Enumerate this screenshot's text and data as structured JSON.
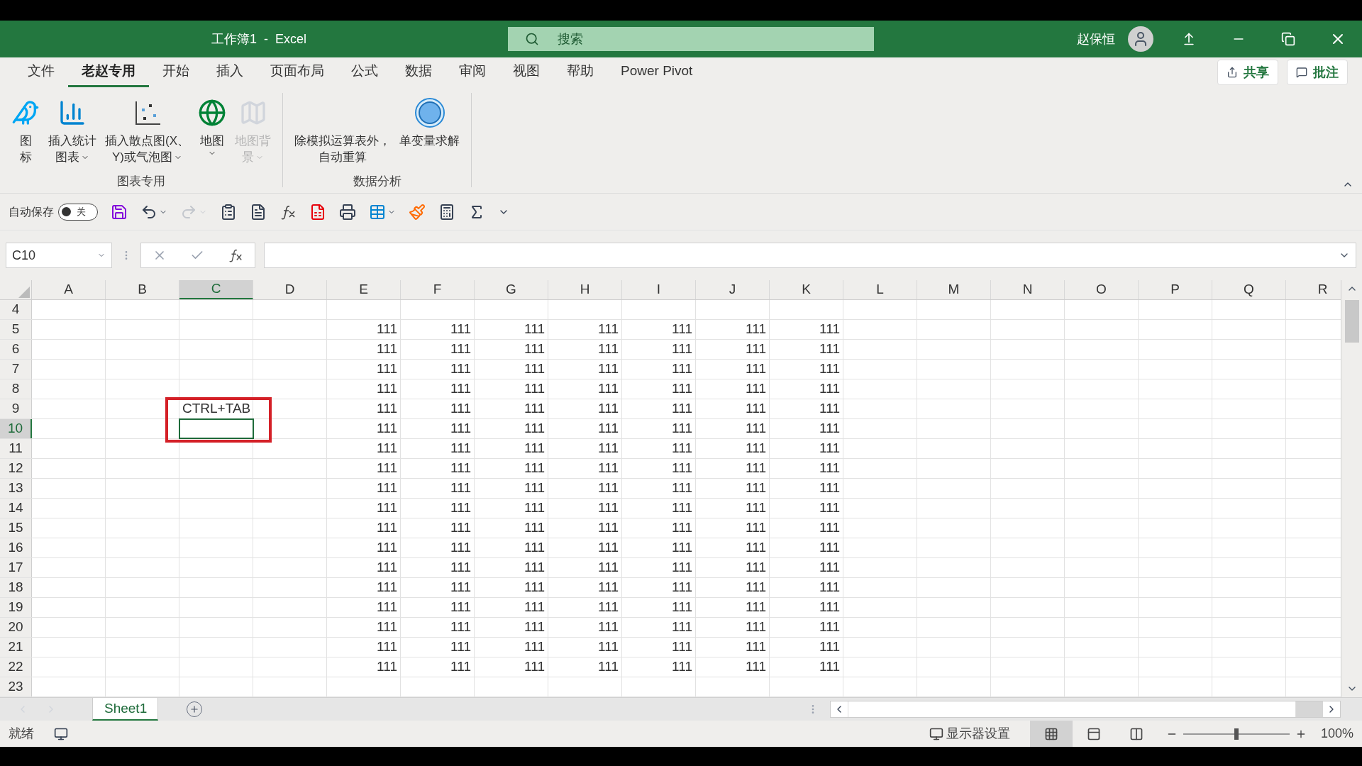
{
  "window": {
    "title": "工作簿1  -  Excel",
    "user": "赵保恒"
  },
  "search": {
    "placeholder": "搜索"
  },
  "ribbon_tabs": [
    {
      "label": "文件",
      "selected": false
    },
    {
      "label": "老赵专用",
      "selected": true
    },
    {
      "label": "开始",
      "selected": false
    },
    {
      "label": "插入",
      "selected": false
    },
    {
      "label": "页面布局",
      "selected": false
    },
    {
      "label": "公式",
      "selected": false
    },
    {
      "label": "数据",
      "selected": false
    },
    {
      "label": "审阅",
      "selected": false
    },
    {
      "label": "视图",
      "selected": false
    },
    {
      "label": "帮助",
      "selected": false
    },
    {
      "label": "Power Pivot",
      "selected": false
    }
  ],
  "ribbon_actions": [
    {
      "kind": "share",
      "label": "共享"
    },
    {
      "kind": "comment",
      "label": "批注"
    }
  ],
  "ribbon_groups": [
    {
      "label": "图表专用",
      "items": [
        {
          "kind": "icons",
          "lines": [
            "图",
            "标"
          ],
          "menu": false,
          "disabled": false
        },
        {
          "kind": "bar_chart",
          "lines": [
            "插入统计",
            "图表"
          ],
          "menu": true,
          "disabled": false
        },
        {
          "kind": "scatter",
          "lines": [
            "插入散点图(X、",
            "Y)或气泡图"
          ],
          "menu": true,
          "disabled": false
        },
        {
          "kind": "globe",
          "lines": [
            "地图"
          ],
          "menu": true,
          "disabled": false
        },
        {
          "kind": "map_background",
          "lines": [
            "地图背",
            "景"
          ],
          "menu": true,
          "disabled": true
        }
      ]
    },
    {
      "label": "数据分析",
      "items": [
        {
          "kind": "recalc",
          "lines": [
            "除模拟运算表外，",
            "自动重算"
          ],
          "menu": false,
          "disabled": false
        },
        {
          "kind": "goal_seek",
          "lines": [
            "单变量求解"
          ],
          "menu": false,
          "disabled": false
        }
      ]
    }
  ],
  "autosave": {
    "label": "自动保存",
    "on": false,
    "state_text": "关"
  },
  "quick_access": [
    {
      "kind": "save",
      "menu": false,
      "disabled": false
    },
    {
      "kind": "undo",
      "menu": true,
      "disabled": false
    },
    {
      "kind": "redo",
      "menu": true,
      "disabled": true
    },
    {
      "kind": "form",
      "menu": false,
      "disabled": false
    },
    {
      "kind": "document",
      "menu": false,
      "disabled": false
    },
    {
      "kind": "function",
      "menu": false,
      "disabled": false
    },
    {
      "kind": "report",
      "menu": false,
      "disabled": false
    },
    {
      "kind": "print",
      "menu": false,
      "disabled": false
    },
    {
      "kind": "freeze",
      "menu": true,
      "disabled": false
    },
    {
      "kind": "brush",
      "menu": false,
      "disabled": false
    },
    {
      "kind": "calculator",
      "menu": false,
      "disabled": false
    },
    {
      "kind": "sum",
      "menu": false,
      "disabled": false
    },
    {
      "kind": "customize",
      "menu": false,
      "disabled": false
    }
  ],
  "formula_bar": {
    "name_box": "C10"
  },
  "columns": [
    {
      "label": "A",
      "selected": false
    },
    {
      "label": "B",
      "selected": false
    },
    {
      "label": "C",
      "selected": true
    },
    {
      "label": "D",
      "selected": false
    },
    {
      "label": "E",
      "selected": false
    },
    {
      "label": "F",
      "selected": false
    },
    {
      "label": "G",
      "selected": false
    },
    {
      "label": "H",
      "selected": false
    },
    {
      "label": "I",
      "selected": false
    },
    {
      "label": "J",
      "selected": false
    },
    {
      "label": "K",
      "selected": false
    },
    {
      "label": "L",
      "selected": false
    },
    {
      "label": "M",
      "selected": false
    },
    {
      "label": "N",
      "selected": false
    },
    {
      "label": "O",
      "selected": false
    },
    {
      "label": "P",
      "selected": false
    },
    {
      "label": "Q",
      "selected": false
    },
    {
      "label": "R",
      "selected": false
    }
  ],
  "rows": [
    {
      "label": "4",
      "selected": false
    },
    {
      "label": "5",
      "selected": false,
      "cells": [
        null,
        null,
        null,
        null,
        "111",
        "111",
        "111",
        "111",
        "111",
        "111",
        "111"
      ]
    },
    {
      "label": "6",
      "selected": false,
      "cells": [
        null,
        null,
        null,
        null,
        "111",
        "111",
        "111",
        "111",
        "111",
        "111",
        "111"
      ]
    },
    {
      "label": "7",
      "selected": false,
      "cells": [
        null,
        null,
        null,
        null,
        "111",
        "111",
        "111",
        "111",
        "111",
        "111",
        "111"
      ]
    },
    {
      "label": "8",
      "selected": false,
      "cells": [
        null,
        null,
        null,
        null,
        "111",
        "111",
        "111",
        "111",
        "111",
        "111",
        "111"
      ]
    },
    {
      "label": "9",
      "selected": false,
      "cells": [
        null,
        null,
        "CTRL+TAB",
        null,
        "111",
        "111",
        "111",
        "111",
        "111",
        "111",
        "111"
      ]
    },
    {
      "label": "10",
      "selected": true,
      "cells": [
        null,
        null,
        null,
        null,
        "111",
        "111",
        "111",
        "111",
        "111",
        "111",
        "111"
      ]
    },
    {
      "label": "11",
      "selected": false,
      "cells": [
        null,
        null,
        null,
        null,
        "111",
        "111",
        "111",
        "111",
        "111",
        "111",
        "111"
      ]
    },
    {
      "label": "12",
      "selected": false,
      "cells": [
        null,
        null,
        null,
        null,
        "111",
        "111",
        "111",
        "111",
        "111",
        "111",
        "111"
      ]
    },
    {
      "label": "13",
      "selected": false,
      "cells": [
        null,
        null,
        null,
        null,
        "111",
        "111",
        "111",
        "111",
        "111",
        "111",
        "111"
      ]
    },
    {
      "label": "14",
      "selected": false,
      "cells": [
        null,
        null,
        null,
        null,
        "111",
        "111",
        "111",
        "111",
        "111",
        "111",
        "111"
      ]
    },
    {
      "label": "15",
      "selected": false,
      "cells": [
        null,
        null,
        null,
        null,
        "111",
        "111",
        "111",
        "111",
        "111",
        "111",
        "111"
      ]
    },
    {
      "label": "16",
      "selected": false,
      "cells": [
        null,
        null,
        null,
        null,
        "111",
        "111",
        "111",
        "111",
        "111",
        "111",
        "111"
      ]
    },
    {
      "label": "17",
      "selected": false,
      "cells": [
        null,
        null,
        null,
        null,
        "111",
        "111",
        "111",
        "111",
        "111",
        "111",
        "111"
      ]
    },
    {
      "label": "18",
      "selected": false,
      "cells": [
        null,
        null,
        null,
        null,
        "111",
        "111",
        "111",
        "111",
        "111",
        "111",
        "111"
      ]
    },
    {
      "label": "19",
      "selected": false,
      "cells": [
        null,
        null,
        null,
        null,
        "111",
        "111",
        "111",
        "111",
        "111",
        "111",
        "111"
      ]
    },
    {
      "label": "20",
      "selected": false,
      "cells": [
        null,
        null,
        null,
        null,
        "111",
        "111",
        "111",
        "111",
        "111",
        "111",
        "111"
      ]
    },
    {
      "label": "21",
      "selected": false,
      "cells": [
        null,
        null,
        null,
        null,
        "111",
        "111",
        "111",
        "111",
        "111",
        "111",
        "111"
      ]
    },
    {
      "label": "22",
      "selected": false,
      "cells": [
        null,
        null,
        null,
        null,
        "111",
        "111",
        "111",
        "111",
        "111",
        "111",
        "111"
      ]
    },
    {
      "label": "23",
      "selected": false
    }
  ],
  "sheets": [
    {
      "label": "Sheet1",
      "selected": true
    }
  ],
  "status_bar": {
    "status": "就绪",
    "display_settings": "显示器设置",
    "views": [
      {
        "kind": "normal",
        "selected": true
      },
      {
        "kind": "page_layout",
        "selected": false
      },
      {
        "kind": "page_break",
        "selected": false
      }
    ],
    "zoom": {
      "level": 0.5,
      "reading": "100%"
    }
  }
}
